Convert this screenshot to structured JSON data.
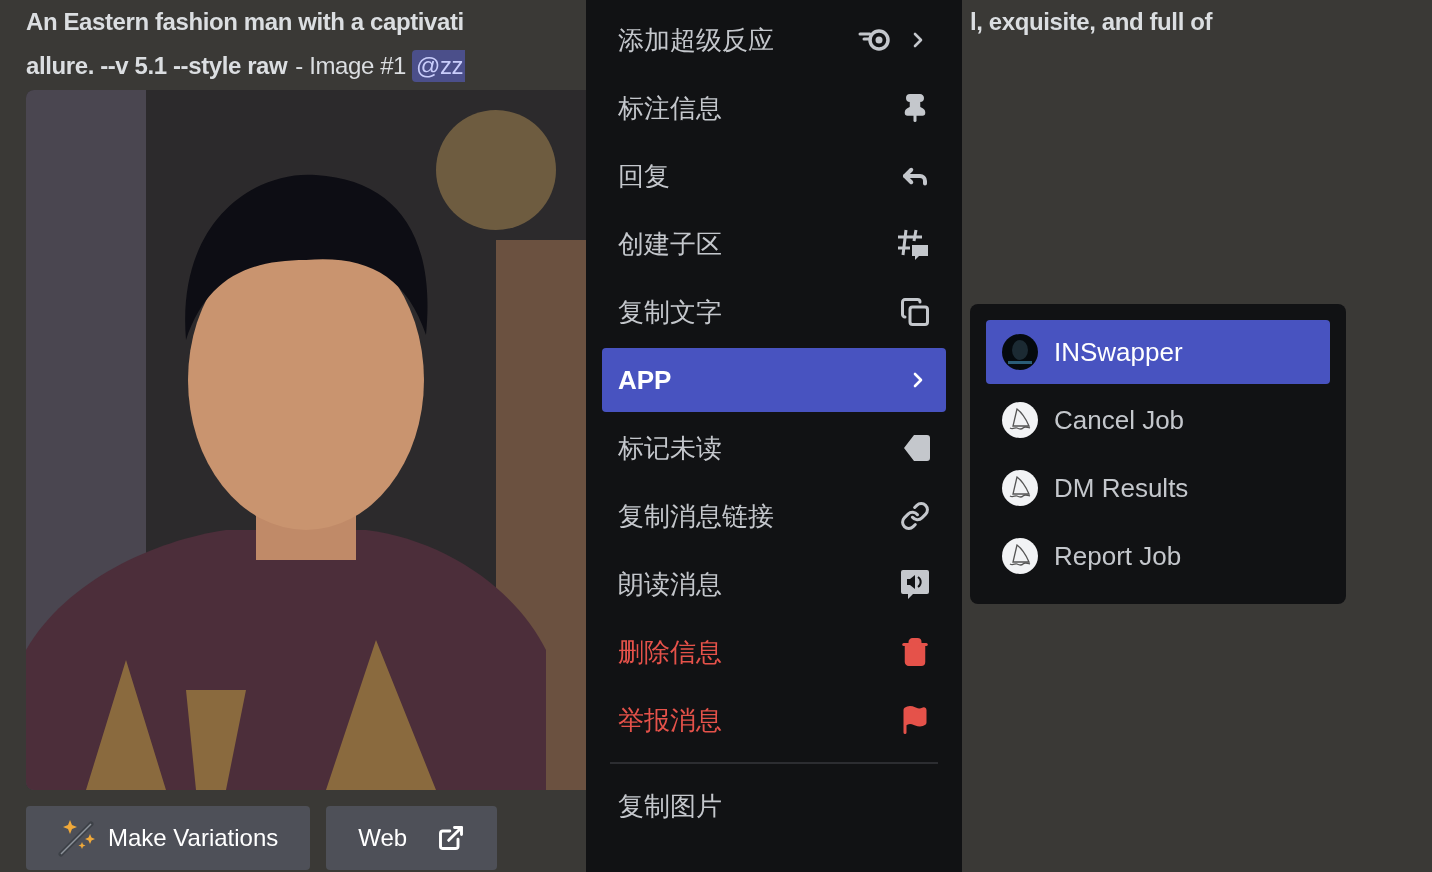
{
  "message": {
    "line_start": "An Eastern fashion man with a captivati",
    "line_end": "l, exquisite, and full of",
    "prompt_end": "allure. --v 5.1 --style raw",
    "suffix": "- Image #1",
    "mention": "@zz"
  },
  "buttons": [
    {
      "label": "Make Variations",
      "kind": "variations"
    },
    {
      "label": "Web",
      "kind": "link"
    }
  ],
  "context_menu": {
    "groups": [
      {
        "items": [
          {
            "label": "添加超级反应",
            "kind": "superreaction",
            "submenu": true,
            "danger": false,
            "selected": false
          },
          {
            "label": "标注信息",
            "kind": "pin",
            "submenu": false,
            "danger": false,
            "selected": false
          },
          {
            "label": "回复",
            "kind": "reply",
            "submenu": false,
            "danger": false,
            "selected": false
          },
          {
            "label": "创建子区",
            "kind": "thread",
            "submenu": false,
            "danger": false,
            "selected": false
          },
          {
            "label": "复制文字",
            "kind": "copy",
            "submenu": false,
            "danger": false,
            "selected": false
          },
          {
            "label": "APP",
            "kind": "plain",
            "submenu": true,
            "danger": false,
            "selected": true
          },
          {
            "label": "标记未读",
            "kind": "unread",
            "submenu": false,
            "danger": false,
            "selected": false
          },
          {
            "label": "复制消息链接",
            "kind": "link",
            "submenu": false,
            "danger": false,
            "selected": false
          },
          {
            "label": "朗读消息",
            "kind": "speak",
            "submenu": false,
            "danger": false,
            "selected": false
          },
          {
            "label": "删除信息",
            "kind": "trash",
            "submenu": false,
            "danger": true,
            "selected": false
          },
          {
            "label": "举报消息",
            "kind": "flag",
            "submenu": false,
            "danger": true,
            "selected": false
          }
        ]
      },
      {
        "items": [
          {
            "label": "复制图片",
            "kind": "plain",
            "submenu": false,
            "danger": false,
            "selected": false
          }
        ]
      }
    ]
  },
  "app_menu": {
    "items": [
      {
        "label": "INSwapper",
        "kind": "dark",
        "selected": true
      },
      {
        "label": "Cancel Job",
        "kind": "boat",
        "selected": false
      },
      {
        "label": "DM Results",
        "kind": "boat",
        "selected": false
      },
      {
        "label": "Report Job",
        "kind": "boat",
        "selected": false
      }
    ]
  }
}
